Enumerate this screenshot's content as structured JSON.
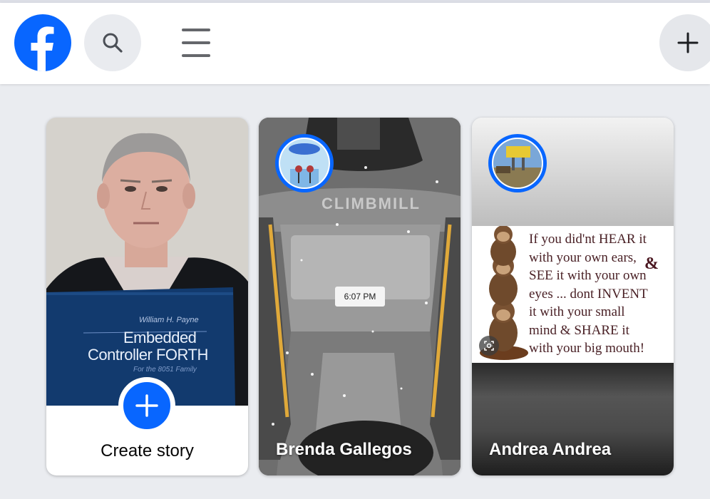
{
  "header": {
    "logo_icon": "facebook-logo-icon",
    "search_icon": "search-icon",
    "menu_icon": "hamburger-menu-icon",
    "create_icon": "plus-icon",
    "brand_color": "#0866ff"
  },
  "stories": {
    "create": {
      "label": "Create story",
      "book_author": "William H. Payne",
      "book_title_line1": "Embedded",
      "book_title_line2": "Controller FORTH",
      "book_subtitle": "For the 8051 Family"
    },
    "items": [
      {
        "name": "Brenda Gallegos",
        "timestamp": "6:07 PM",
        "machine_text": "CLIMBMILL"
      },
      {
        "name": "Andrea Andrea",
        "quote": {
          "l1": "If you did'nt HEAR it",
          "l2": "with your own ears,",
          "amp": "&",
          "l3": "SEE it with your own",
          "l4": "eyes ... dont INVENT",
          "l5": "it with your small",
          "l6": "mind & SHARE it",
          "l7": "with your big mouth!"
        },
        "overlay_icon": "lens-search-icon"
      }
    ]
  }
}
